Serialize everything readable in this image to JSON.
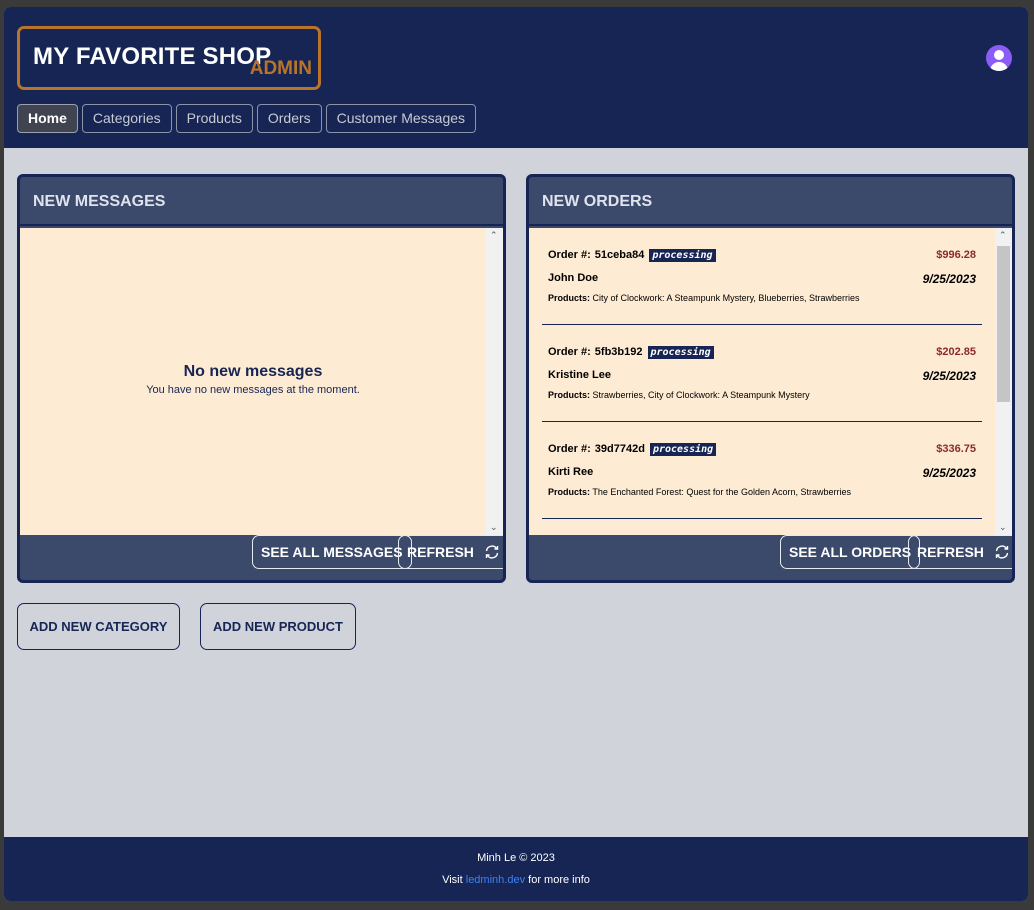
{
  "header": {
    "title": "MY FAVORITE SHOP",
    "subtitle": "ADMIN",
    "avatar_icon": "user-avatar-icon",
    "tabs": [
      {
        "label": "Home",
        "active": true
      },
      {
        "label": "Categories",
        "active": false
      },
      {
        "label": "Products",
        "active": false
      },
      {
        "label": "Orders",
        "active": false
      },
      {
        "label": "Customer Messages",
        "active": false
      }
    ]
  },
  "messages": {
    "title": "NEW MESSAGES",
    "empty_title": "No new messages",
    "empty_text": "You have no new messages at the moment.",
    "see_all": "SEE ALL MESSAGES",
    "refresh": "REFRESH"
  },
  "orders": {
    "title": "NEW ORDERS",
    "see_all": "SEE ALL ORDERS",
    "refresh": "REFRESH",
    "order_label": "Order #:",
    "products_label": "Products:",
    "items": [
      {
        "id": "51ceba84",
        "status": "processing",
        "price": "$996.28",
        "customer": "John Doe",
        "date": "9/25/2023",
        "products": "City of Clockwork: A Steampunk Mystery, Blueberries, Strawberries"
      },
      {
        "id": "5fb3b192",
        "status": "processing",
        "price": "$202.85",
        "customer": "Kristine Lee",
        "date": "9/25/2023",
        "products": "Strawberries, City of Clockwork: A Steampunk Mystery"
      },
      {
        "id": "39d7742d",
        "status": "processing",
        "price": "$336.75",
        "customer": "Kirti Ree",
        "date": "9/25/2023",
        "products": "The Enchanted Forest: Quest for the Golden Acorn, Strawberries"
      }
    ]
  },
  "actions": {
    "add_category": "ADD NEW CATEGORY",
    "add_product": "ADD NEW PRODUCT"
  },
  "footer": {
    "copyright": "Minh Le © 2023",
    "visit": "Visit",
    "link": "ledminh.dev",
    "more": "for more info"
  },
  "colors": {
    "navy": "#172554",
    "accent": "#b8752a",
    "price": "#8b2b2b",
    "panel_body": "#fdebd3"
  }
}
